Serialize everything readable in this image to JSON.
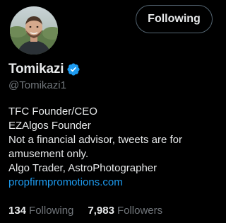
{
  "profile": {
    "display_name": "Tomikazi",
    "handle": "@Tomikazi1",
    "verified_icon": "verified-badge-icon",
    "verified_color": "#1d9bf0"
  },
  "follow_button": {
    "label": "Following"
  },
  "bio": {
    "lines": [
      "TFC Founder/CEO",
      "EZAlgos Founder",
      "Not a financial advisor, tweets are for",
      "amusement only.",
      "Algo Trader, AstroPhotographer"
    ],
    "link": "propfirmpromotions.com"
  },
  "stats": {
    "following_count": "134",
    "following_label": "Following",
    "followers_count": "7,983",
    "followers_label": "Followers"
  },
  "colors": {
    "background": "#000000",
    "primary_text": "#e7e9ea",
    "secondary_text": "#71767b",
    "accent": "#1d9bf0"
  }
}
